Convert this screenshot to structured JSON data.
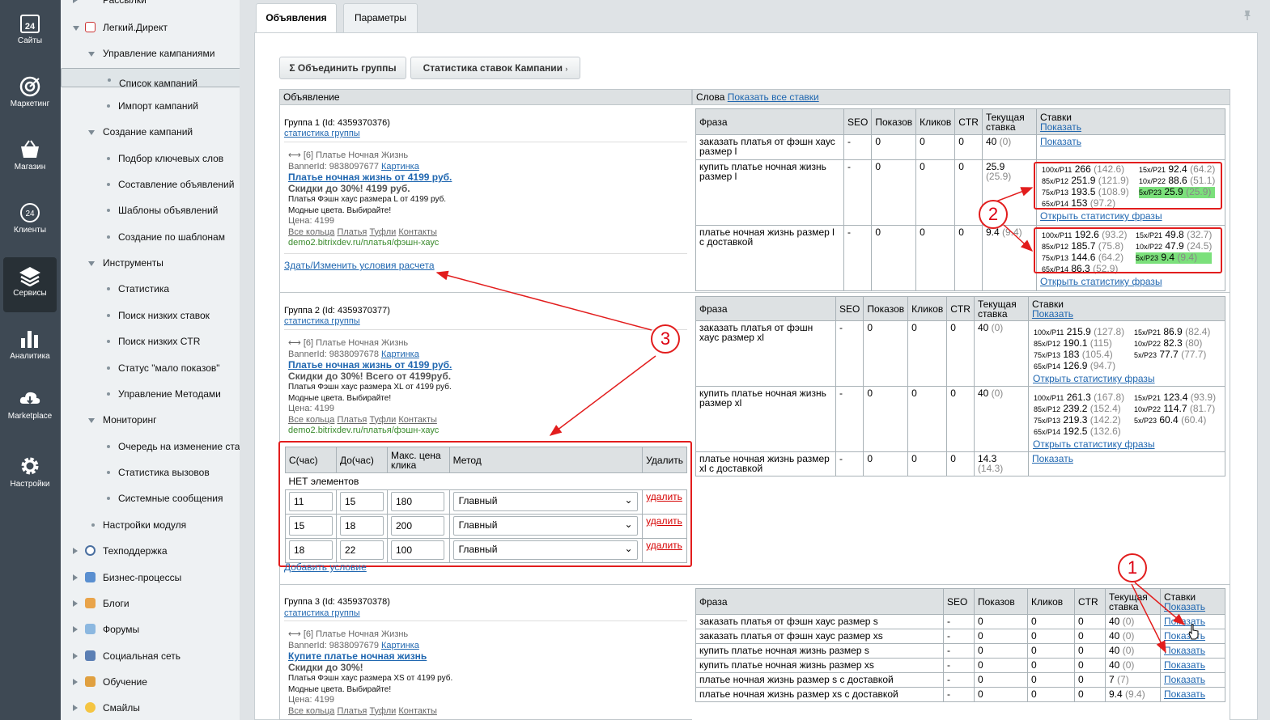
{
  "leftbar": [
    {
      "label": "Сайты",
      "icon": "calendar-24-icon"
    },
    {
      "label": "Маркетинг",
      "icon": "target-icon"
    },
    {
      "label": "Магазин",
      "icon": "basket-icon"
    },
    {
      "label": "Клиенты",
      "icon": "clients-24-icon"
    },
    {
      "label": "Сервисы",
      "icon": "layers-icon"
    },
    {
      "label": "Аналитика",
      "icon": "bar-chart-icon"
    },
    {
      "label": "Marketplace",
      "icon": "cloud-download-icon"
    },
    {
      "label": "Настройки",
      "icon": "gear-icon"
    }
  ],
  "menu": {
    "top_cut": "Рассылки",
    "items": [
      {
        "label": "Легкий.Директ"
      },
      {
        "label": "Управление кампаниями"
      },
      {
        "label": "Список кампаний"
      },
      {
        "label": "Импорт кампаний"
      },
      {
        "label": "Создание кампаний"
      },
      {
        "label": "Подбор ключевых слов"
      },
      {
        "label": "Составление объявлений"
      },
      {
        "label": "Шаблоны объявлений"
      },
      {
        "label": "Создание по шаблонам"
      },
      {
        "label": "Инструменты"
      },
      {
        "label": "Статистика"
      },
      {
        "label": "Поиск низких ставок"
      },
      {
        "label": "Поиск низких CTR"
      },
      {
        "label": "Статус \"мало показов\""
      },
      {
        "label": "Управление Методами"
      },
      {
        "label": "Мониторинг"
      },
      {
        "label": "Очередь на изменение ставок"
      },
      {
        "label": "Статистика вызовов"
      },
      {
        "label": "Системные сообщения"
      },
      {
        "label": "Настройки модуля"
      },
      {
        "label": "Техподдержка"
      },
      {
        "label": "Бизнес-процессы"
      },
      {
        "label": "Блоги"
      },
      {
        "label": "Форумы"
      },
      {
        "label": "Социальная сеть"
      },
      {
        "label": "Обучение"
      },
      {
        "label": "Смайлы"
      }
    ]
  },
  "tabs": [
    "Объявления",
    "Параметры"
  ],
  "toolbar": {
    "merge": "Σ Объединить группы",
    "stats": "Статистика ставок Кампании"
  },
  "col_ad": "Объявление",
  "col_words": "Слова",
  "show_all_bids": "Показать все ставки",
  "headers": {
    "phrase": "Фраза",
    "seo": "SEO",
    "shows": "Показов",
    "clicks": "Кликов",
    "ctr": "CTR",
    "cur_bid": "Текущая ставка",
    "bids": "Ставки",
    "show": "Показать"
  },
  "open_stats": "Открыть статистику фразы",
  "groups": [
    {
      "title": "Группа 1 (Id: 4359370376)",
      "group_stats": "статистика группы",
      "ad_head": "⟷ [6] Платье Ночная Жизнь",
      "banner": "BannerId: 9838097677",
      "picture": "Картинка",
      "ad_title": "Платье ночная жизнь от 4199 руб.",
      "ad_sub": "Скидки до 30%! 4199 руб.",
      "ad_text1": "Платья Фэшн хаус размера L от 4199 руб.",
      "ad_text2": "Модные цвета. Выбирайте!",
      "price": "Цена: 4199",
      "sitelinks": [
        "Все кольца",
        "Платья",
        "Туфли",
        "Контакты"
      ],
      "url": "demo2.bitrixdev.ru/платья/фэшн-хаус",
      "edit_link": "Здать/Изменить условия расчета",
      "phrases": [
        {
          "phrase": "заказать платья от фэшн хаус размер l",
          "seo": "-",
          "shows": "0",
          "clicks": "0",
          "ctr": "0",
          "bid": "40",
          "bid_p": "(0)",
          "bids_link": "Показать"
        },
        {
          "phrase": "купить платье ночная жизнь размер l",
          "seo": "-",
          "shows": "0",
          "clicks": "0",
          "ctr": "0",
          "bid": "25.9",
          "bid_p": "(25.9)",
          "bids": [
            [
              "100x/P11",
              "266",
              "(142.6)",
              "15x/P21",
              "92.4",
              "(64.2)"
            ],
            [
              "85x/P12",
              "251.9",
              "(121.9)",
              "10x/P22",
              "88.6",
              "(51.1)"
            ],
            [
              "75x/P13",
              "193.5",
              "(108.9)",
              "5x/P23",
              "25.9",
              "(25.9)"
            ],
            [
              "65x/P14",
              "153",
              "(97.2)",
              "",
              "",
              ""
            ]
          ]
        },
        {
          "phrase": "платье ночная жизнь размер l с доставкой",
          "seo": "-",
          "shows": "0",
          "clicks": "0",
          "ctr": "0",
          "bid": "9.4",
          "bid_p": "(9.4)",
          "bids": [
            [
              "100x/P11",
              "192.6",
              "(93.2)",
              "15x/P21",
              "49.8",
              "(32.7)"
            ],
            [
              "85x/P12",
              "185.7",
              "(75.8)",
              "10x/P22",
              "47.9",
              "(24.5)"
            ],
            [
              "75x/P13",
              "144.6",
              "(64.2)",
              "5x/P23",
              "9.4",
              "(9.4)"
            ],
            [
              "65x/P14",
              "86.3",
              "(52.9)",
              "",
              "",
              ""
            ]
          ]
        }
      ]
    },
    {
      "title": "Группа 2 (Id: 4359370377)",
      "group_stats": "статистика группы",
      "ad_head": "⟷ [6] Платье Ночная Жизнь",
      "banner": "BannerId: 9838097678",
      "picture": "Картинка",
      "ad_title": "Платье ночная жизнь от 4199 руб.",
      "ad_sub": "Скидки до 30%! Всего от 4199руб.",
      "ad_text1": "Платья Фэшн хаус размера XL от 4199 руб.",
      "ad_text2": "Модные цвета. Выбирайте!",
      "price": "Цена: 4199",
      "sitelinks": [
        "Все кольца",
        "Платья",
        "Туфли",
        "Контакты"
      ],
      "url": "demo2.bitrixdev.ru/платья/фэшн-хаус",
      "cond_headers": [
        "С(час)",
        "До(час)",
        "Макс. цена клика",
        "Метод",
        "Удалить"
      ],
      "cond_empty": "НЕТ элементов",
      "conditions": [
        {
          "from": "11",
          "to": "15",
          "max": "180",
          "method": "Главный",
          "del": "удалить"
        },
        {
          "from": "15",
          "to": "18",
          "max": "200",
          "method": "Главный",
          "del": "удалить"
        },
        {
          "from": "18",
          "to": "22",
          "max": "100",
          "method": "Главный",
          "del": "удалить"
        }
      ],
      "add_cond": "Добавить условие",
      "phrases": [
        {
          "phrase": "заказать платья от фэшн хаус размер xl",
          "seo": "-",
          "shows": "0",
          "clicks": "0",
          "ctr": "0",
          "bid": "40",
          "bid_p": "(0)",
          "bids": [
            [
              "100x/P11",
              "215.9",
              "(127.8)",
              "15x/P21",
              "86.9",
              "(82.4)"
            ],
            [
              "85x/P12",
              "190.1",
              "(115)",
              "10x/P22",
              "82.3",
              "(80)"
            ],
            [
              "75x/P13",
              "183",
              "(105.4)",
              "5x/P23",
              "77.7",
              "(77.7)"
            ],
            [
              "65x/P14",
              "126.9",
              "(94.7)",
              "",
              "",
              ""
            ]
          ]
        },
        {
          "phrase": "купить платье ночная жизнь размер xl",
          "seo": "-",
          "shows": "0",
          "clicks": "0",
          "ctr": "0",
          "bid": "40",
          "bid_p": "(0)",
          "bids": [
            [
              "100x/P11",
              "261.3",
              "(167.8)",
              "15x/P21",
              "123.4",
              "(93.9)"
            ],
            [
              "85x/P12",
              "239.2",
              "(152.4)",
              "10x/P22",
              "114.7",
              "(81.7)"
            ],
            [
              "75x/P13",
              "219.3",
              "(142.2)",
              "5x/P23",
              "60.4",
              "(60.4)"
            ],
            [
              "65x/P14",
              "192.5",
              "(132.6)",
              "",
              "",
              ""
            ]
          ]
        },
        {
          "phrase": "платье ночная жизнь размер xl с доставкой",
          "seo": "-",
          "shows": "0",
          "clicks": "0",
          "ctr": "0",
          "bid": "14.3",
          "bid_p": "(14.3)",
          "bids_link": "Показать"
        }
      ]
    },
    {
      "title": "Группа 3 (Id: 4359370378)",
      "group_stats": "статистика группы",
      "ad_head": "⟷ [6] Платье Ночная Жизнь",
      "banner": "BannerId: 9838097679",
      "picture": "Картинка",
      "ad_title": "Купите платье ночная жизнь",
      "ad_sub": "Скидки до 30%!",
      "ad_text1": "Платья Фэшн хаус размера XS от 4199 руб.",
      "ad_text2": "Модные цвета. Выбирайте!",
      "price": "Цена: 4199",
      "sitelinks": [
        "Все кольца",
        "Платья",
        "Туфли",
        "Контакты"
      ],
      "phrases": [
        {
          "phrase": "заказать платья от фэшн хаус размер s",
          "seo": "-",
          "shows": "0",
          "clicks": "0",
          "ctr": "0",
          "bid": "40",
          "bid_p": "(0)",
          "bids_link": "Показать"
        },
        {
          "phrase": "заказать платья от фэшн хаус размер xs",
          "seo": "-",
          "shows": "0",
          "clicks": "0",
          "ctr": "0",
          "bid": "40",
          "bid_p": "(0)",
          "bids_link": "Показать"
        },
        {
          "phrase": "купить платье ночная жизнь размер s",
          "seo": "-",
          "shows": "0",
          "clicks": "0",
          "ctr": "0",
          "bid": "40",
          "bid_p": "(0)",
          "bids_link": "Показать"
        },
        {
          "phrase": "купить платье ночная жизнь размер xs",
          "seo": "-",
          "shows": "0",
          "clicks": "0",
          "ctr": "0",
          "bid": "40",
          "bid_p": "(0)",
          "bids_link": "Показать"
        },
        {
          "phrase": "платье ночная жизнь размер s с доставкой",
          "seo": "-",
          "shows": "0",
          "clicks": "0",
          "ctr": "0",
          "bid": "7",
          "bid_p": "(7)",
          "bids_link": "Показать"
        },
        {
          "phrase": "платье ночная жизнь размер xs с доставкой",
          "seo": "-",
          "shows": "0",
          "clicks": "0",
          "ctr": "0",
          "bid": "9.4",
          "bid_p": "(9.4)",
          "bids_link": "Показать"
        }
      ]
    }
  ],
  "annotations": {
    "one": "1",
    "two": "2",
    "three": "3"
  },
  "colors": {
    "red": "#e21d1d",
    "link": "#2067b0",
    "highlight": "#7be07b",
    "sidebar": "#3e4954"
  }
}
